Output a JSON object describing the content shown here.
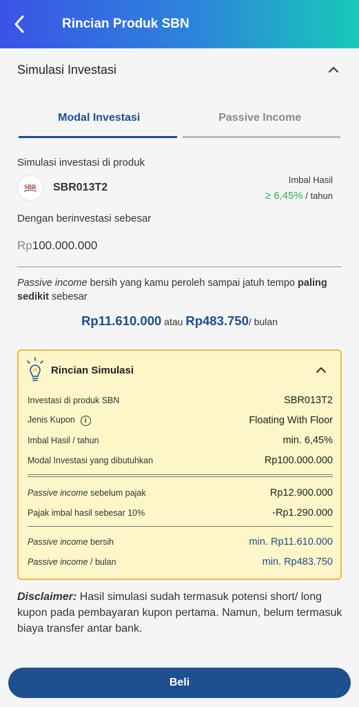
{
  "header": {
    "title": "Rincian Produk SBN",
    "back_icon": "back-arrow-icon"
  },
  "section": {
    "title": "Simulasi Investasi",
    "toggle_icon": "chevron-up-icon"
  },
  "tabs": [
    {
      "label": "Modal Investasi",
      "active": true
    },
    {
      "label": "Passive Income",
      "active": false
    }
  ],
  "product": {
    "intro": "Simulasi investasi di produk",
    "logo_text": "SBR",
    "code": "SBR013T2",
    "yield_label": "Imbal Hasil",
    "yield_value": "≥ 6,45%",
    "yield_unit": " / tahun"
  },
  "investment": {
    "label": "Dengan berinvestasi sebesar",
    "currency": "Rp",
    "amount": "100.000.000"
  },
  "passive": {
    "part1": "Passive income",
    "part2": " bersih yang kamu peroleh sampai jatuh tempo ",
    "part3": "paling sedikit",
    "part4": " sebesar",
    "total": "Rp11.610.000",
    "connector": " atau ",
    "monthly": "Rp483.750",
    "monthly_unit": "/ bulan"
  },
  "detail": {
    "title": "Rincian Simulasi",
    "icon": "lightbulb-icon",
    "rows": [
      {
        "label": "Investasi di produk SBN",
        "value": "SBR013T2"
      },
      {
        "label": "Jenis Kupon",
        "value": "Floating With Floor"
      },
      {
        "label": "Imbal Hasil / tahun",
        "value": "min. 6,45%"
      },
      {
        "label": "Modal Investasi yang dibutuhkan",
        "value": "Rp100.000.000"
      }
    ],
    "tax_rows": [
      {
        "label_italic": "Passive income",
        "label_rest": " sebelum pajak",
        "value": "Rp12.900.000"
      },
      {
        "label_italic": "",
        "label_rest": "Pajak imbal hasil sebesar 10%",
        "value": "-Rp1.290.000"
      }
    ],
    "net_rows": [
      {
        "label_italic": "Passive income",
        "label_rest": " bersih",
        "value": "min. Rp11.610.000"
      },
      {
        "label_italic": "Passive income",
        "label_rest": " / bulan",
        "value": "min. Rp483.750"
      }
    ]
  },
  "disclaimer": {
    "label": "Disclaimer:",
    "text": " Hasil simulasi sudah termasuk potensi short/ long kupon pada pembayaran kupon pertama. Namun, belum termasuk biaya transfer antar bank."
  },
  "cta": {
    "label": "Beli"
  },
  "colors": {
    "primary": "#1d4f91",
    "accent_green": "#2bb34a",
    "card_bg": "#fdf6c9",
    "card_border": "#f2b84a"
  }
}
